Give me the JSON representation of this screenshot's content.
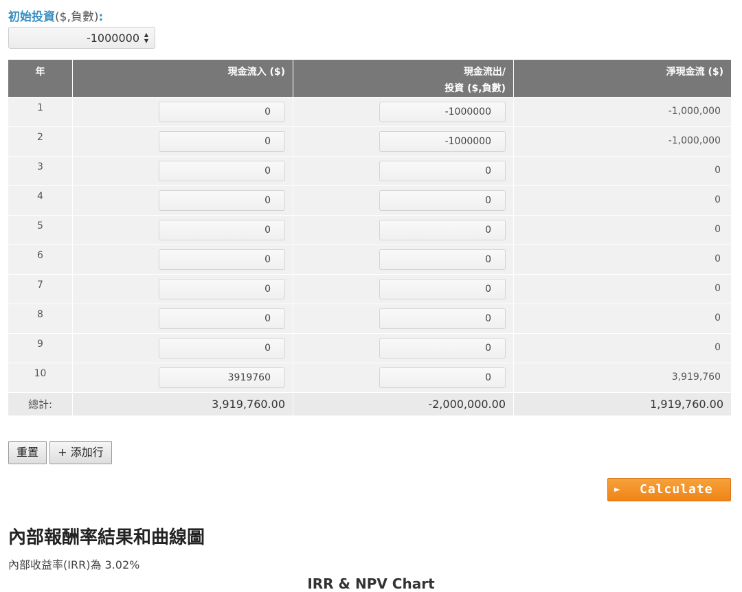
{
  "initial_investment": {
    "label_main": "初始投資",
    "label_paren": "($,負數)",
    "label_colon": ":",
    "value": "-1000000"
  },
  "table": {
    "headers": {
      "year": "年",
      "inflow": "現金流入 ($)",
      "outflow_line1": "現金流出/",
      "outflow_line2": "投資 ($,負數)",
      "net": "淨現金流 ($)"
    },
    "rows": [
      {
        "year": "1",
        "inflow": "0",
        "outflow": "-1000000",
        "net": "-1,000,000"
      },
      {
        "year": "2",
        "inflow": "0",
        "outflow": "-1000000",
        "net": "-1,000,000"
      },
      {
        "year": "3",
        "inflow": "0",
        "outflow": "0",
        "net": "0"
      },
      {
        "year": "4",
        "inflow": "0",
        "outflow": "0",
        "net": "0"
      },
      {
        "year": "5",
        "inflow": "0",
        "outflow": "0",
        "net": "0"
      },
      {
        "year": "6",
        "inflow": "0",
        "outflow": "0",
        "net": "0"
      },
      {
        "year": "7",
        "inflow": "0",
        "outflow": "0",
        "net": "0"
      },
      {
        "year": "8",
        "inflow": "0",
        "outflow": "0",
        "net": "0"
      },
      {
        "year": "9",
        "inflow": "0",
        "outflow": "0",
        "net": "0"
      },
      {
        "year": "10",
        "inflow": "3919760",
        "outflow": "0",
        "net": "3,919,760"
      }
    ],
    "totals": {
      "label": "總計:",
      "inflow": "3,919,760.00",
      "outflow": "-2,000,000.00",
      "net": "1,919,760.00"
    }
  },
  "buttons": {
    "reset": "重置",
    "add_row": "+ 添加行",
    "calculate": "Calculate",
    "calculate_icon": "play-arrow-icon"
  },
  "results": {
    "heading": "內部報酬率結果和曲線圖",
    "irr_text": "內部收益率(IRR)為 3.02%",
    "chart_title": "IRR & NPV Chart"
  },
  "colors": {
    "label_blue": "#3a8fc2",
    "header_gray": "#787878",
    "calc_orange": "#f39322"
  }
}
